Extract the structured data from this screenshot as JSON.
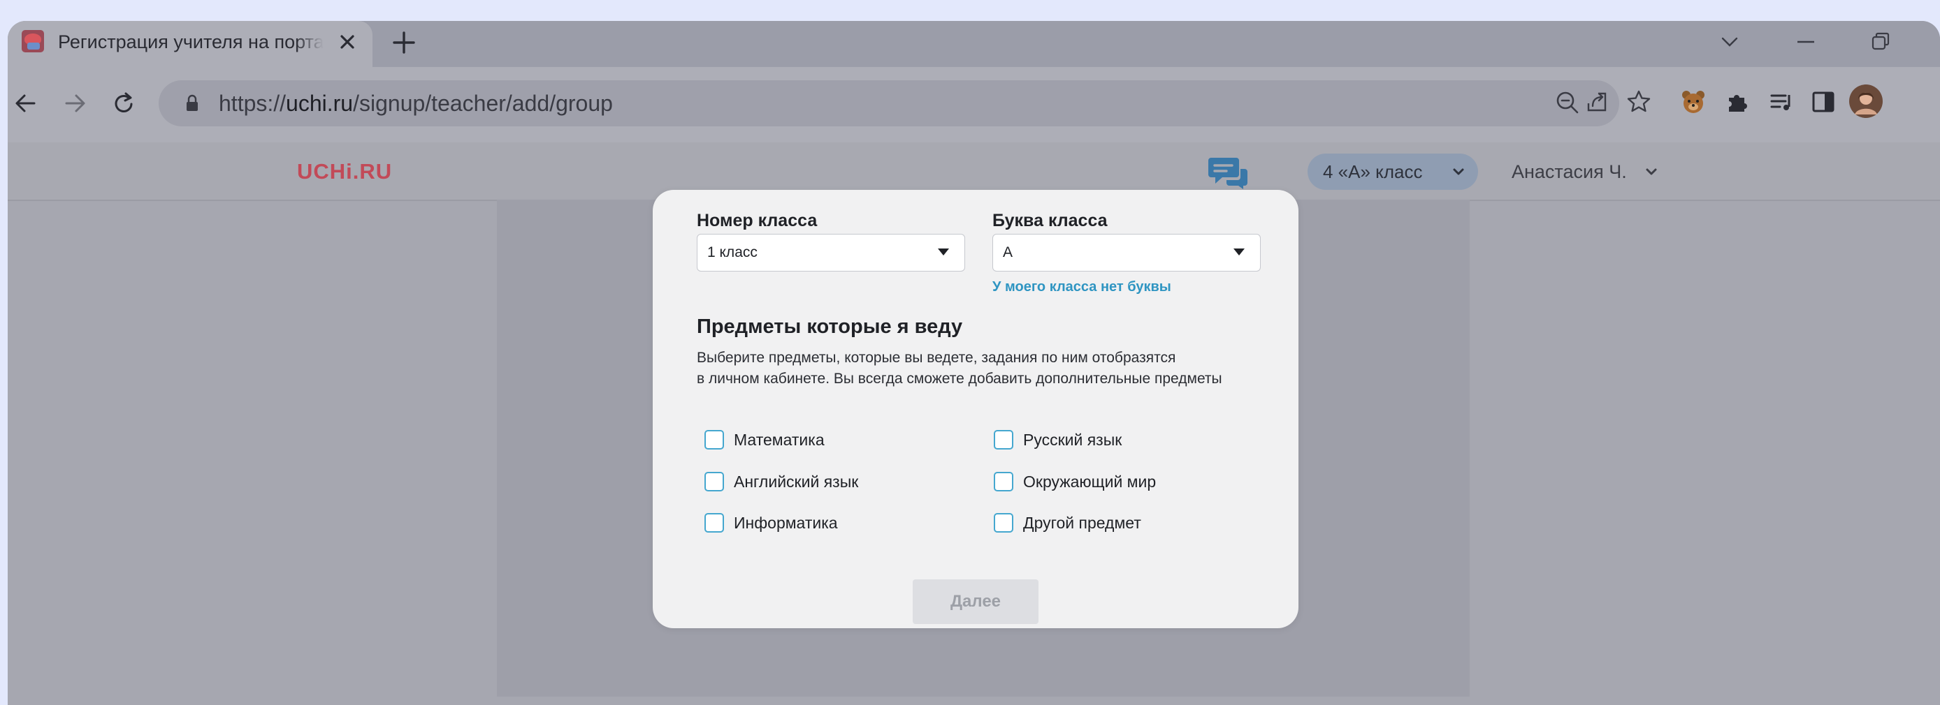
{
  "browser": {
    "tab": {
      "title": "Регистрация учителя на портале"
    },
    "address_bar": {
      "scheme": "https://",
      "host": "uchi.ru",
      "path": "/signup/teacher/add/group"
    }
  },
  "header": {
    "logo": "UCHi.RU",
    "class_selector": {
      "label": "4 «А» класс"
    },
    "user": {
      "name": "Анастасия Ч."
    }
  },
  "form": {
    "class_number": {
      "label": "Номер класса",
      "value": "1 класс"
    },
    "class_letter": {
      "label": "Буква класса",
      "value": "А"
    },
    "no_letter_link": "У моего класса нет буквы",
    "subjects": {
      "title": "Предметы которые я веду",
      "description_line1": "Выберите предметы, которые вы ведете, задания по ним отобразятся",
      "description_line2": "в личном кабинете. Вы всегда сможете добавить дополнительные предметы",
      "items": [
        {
          "label": "Математика",
          "checked": false
        },
        {
          "label": "Русский язык",
          "checked": false
        },
        {
          "label": "Английский язык",
          "checked": false
        },
        {
          "label": "Окружающий мир",
          "checked": false
        },
        {
          "label": "Информатика",
          "checked": false
        },
        {
          "label": "Другой предмет",
          "checked": false
        }
      ]
    },
    "next_button": "Далее"
  },
  "colors": {
    "page_background": "#e3e8fc",
    "overlay_gray": "#a6a7b0",
    "logo_red": "#c24a58",
    "link_blue": "#2f95c2",
    "checkbox_border": "#45a7cf",
    "modal_background": "#f1f1f2",
    "disabled_button": "#dddee2"
  }
}
